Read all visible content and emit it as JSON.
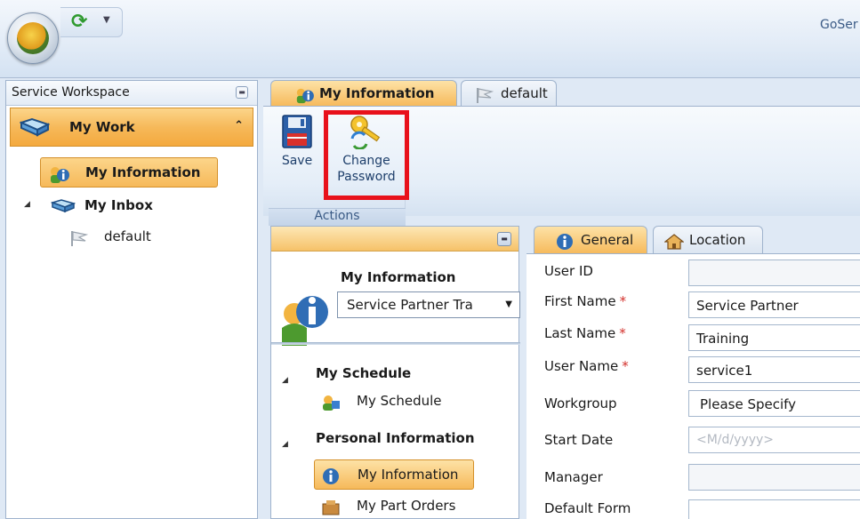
{
  "app": {
    "title": "GoSer"
  },
  "workspace": {
    "title": "Service Workspace",
    "group": "My Work",
    "items": [
      {
        "label": "My Information"
      },
      {
        "label": "My Inbox"
      },
      {
        "label": "default"
      }
    ]
  },
  "tabs": [
    {
      "label": "My Information"
    },
    {
      "label": "default"
    }
  ],
  "ribbon": {
    "save_label": "Save",
    "change_password_label": "Change\nPassword",
    "group_label": "Actions"
  },
  "navpane": {
    "title": "My Information",
    "select_value": "Service Partner Tra",
    "sections": [
      {
        "label": "My Schedule",
        "items": [
          "My Schedule"
        ]
      },
      {
        "label": "Personal Information",
        "items": [
          "My Information",
          "My Part Orders"
        ]
      }
    ]
  },
  "form": {
    "tabs": [
      "General",
      "Location"
    ],
    "fields": {
      "user_id": {
        "label": "User ID",
        "value": ""
      },
      "first_name": {
        "label": "First Name",
        "value": "Service Partner"
      },
      "last_name": {
        "label": "Last Name",
        "value": "Training"
      },
      "user_name": {
        "label": "User Name",
        "value": "service1"
      },
      "workgroup": {
        "label": "Workgroup",
        "value": "Please Specify"
      },
      "start_date": {
        "label": "Start Date",
        "placeholder": "<M/d/yyyy>"
      },
      "manager": {
        "label": "Manager",
        "value": ""
      },
      "default_form": {
        "label": "Default Form",
        "value": ""
      }
    },
    "required_mark": "*"
  },
  "colors": {
    "accent": "#f6b95a",
    "highlight": "#e8111b",
    "frame": "#9fb3cd"
  }
}
